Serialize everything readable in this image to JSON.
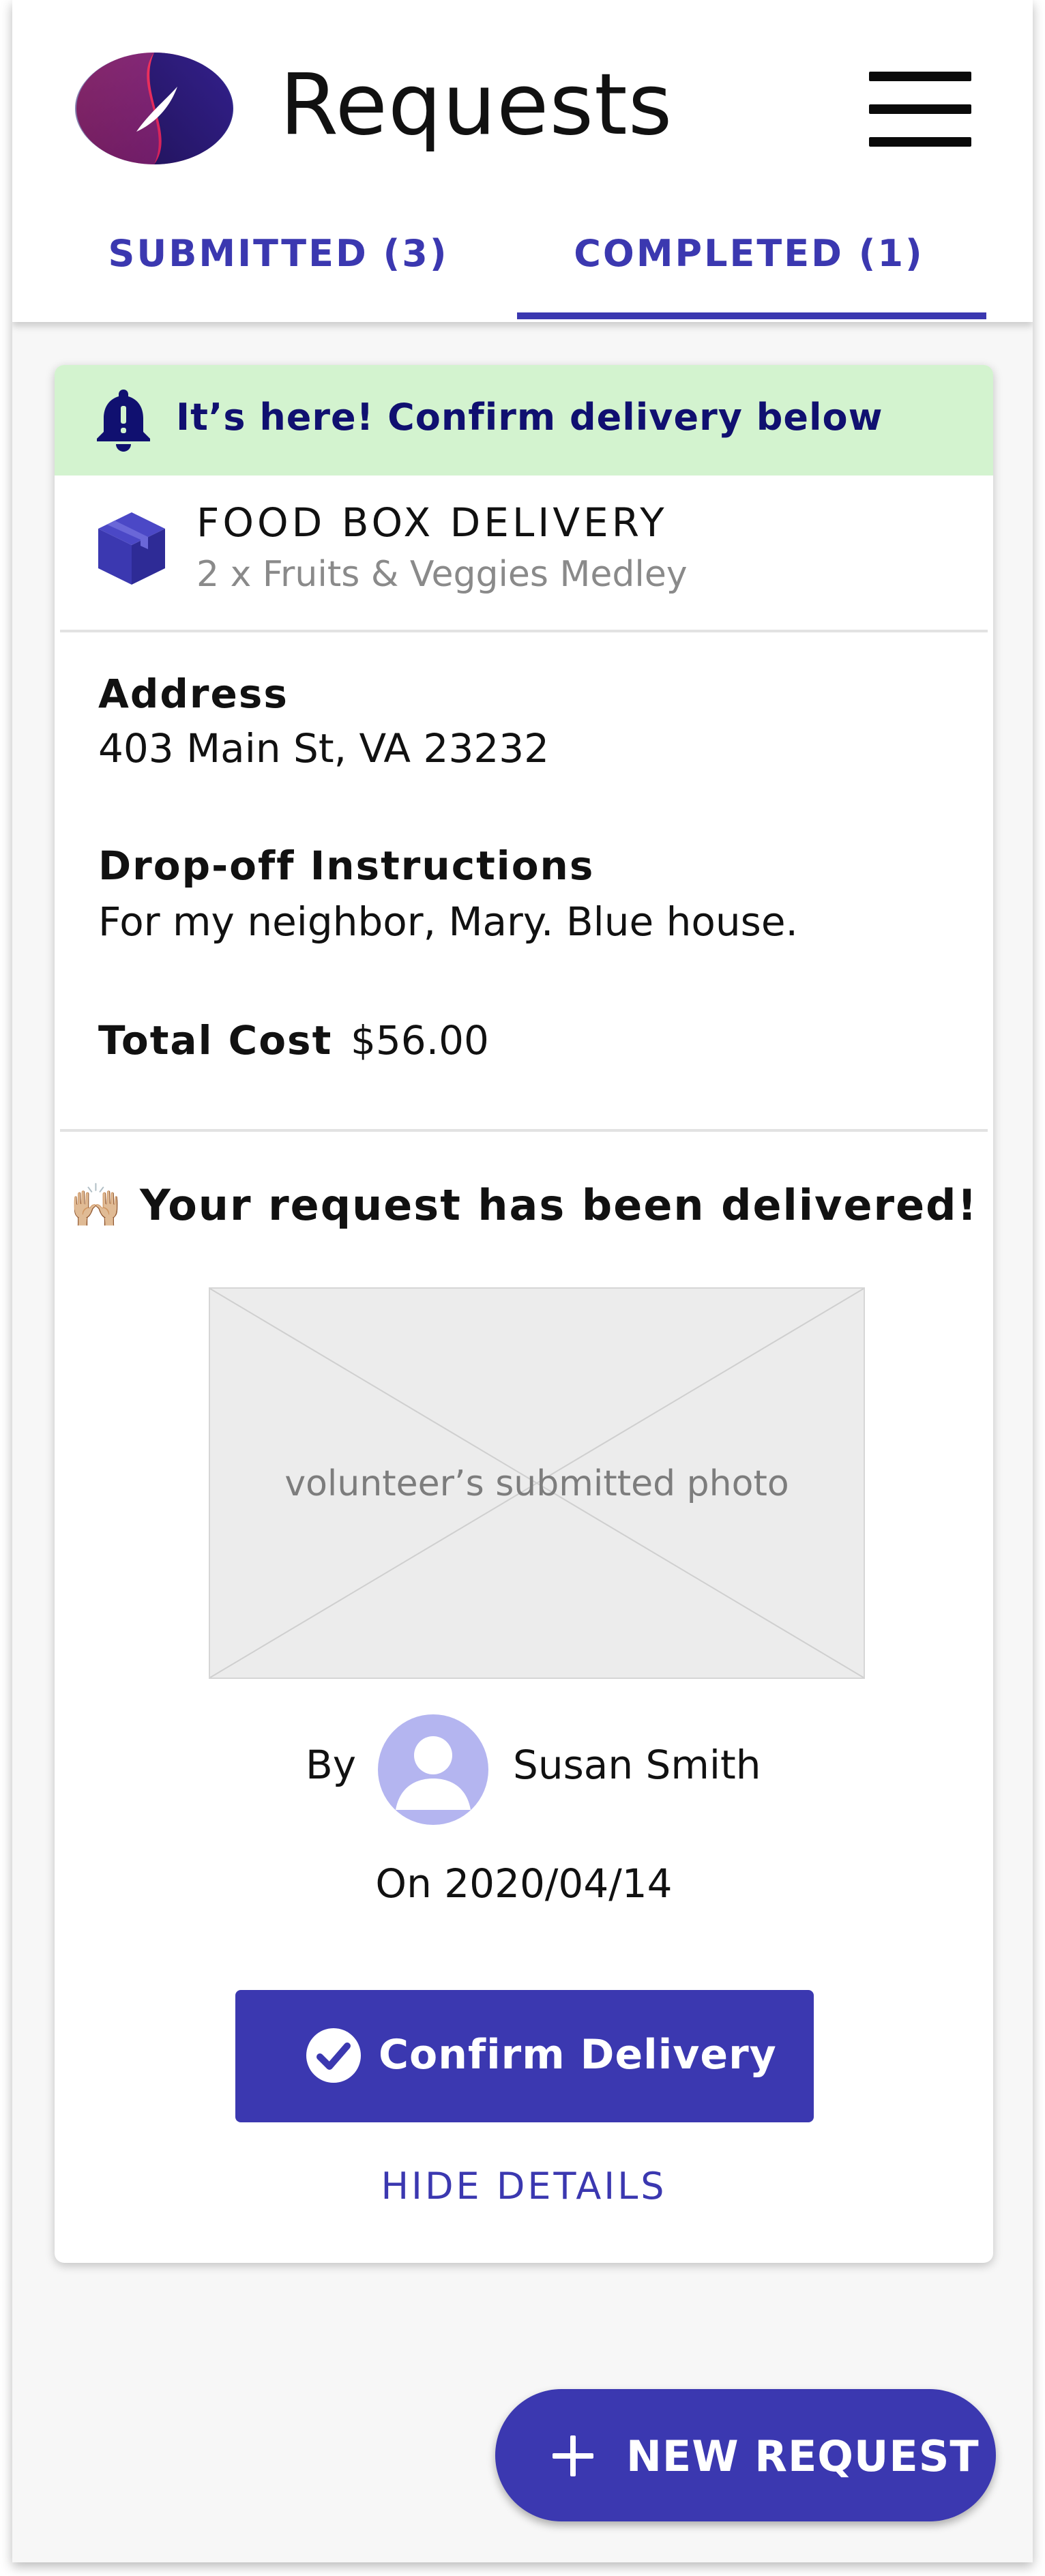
{
  "header": {
    "title": "Requests",
    "logo_icon": "app-logo",
    "menu_icon": "hamburger-menu-icon"
  },
  "tabs": [
    {
      "label": "SUBMITTED (3)",
      "active": false
    },
    {
      "label": "COMPLETED (1)",
      "active": true
    }
  ],
  "card": {
    "banner": {
      "icon": "bell-alert-icon",
      "text": "It’s here! Confirm delivery below"
    },
    "item": {
      "icon": "box-icon",
      "title": "FOOD BOX DELIVERY",
      "subtitle": "2 x Fruits & Veggies Medley"
    },
    "address": {
      "label": "Address",
      "value": "403 Main St, VA 23232"
    },
    "instructions": {
      "label": "Drop-off Instructions",
      "value": "For my neighbor, Mary. Blue house."
    },
    "cost": {
      "label": "Total Cost",
      "value": "$56.00"
    },
    "delivery": {
      "message": "🙌🏼 Your request has been delivered!",
      "photo_placeholder": "volunteer’s submitted photo",
      "by_label": "By",
      "volunteer_name": "Susan Smith",
      "date": "On 2020/04/14"
    },
    "confirm_button": {
      "icon": "check-circle-icon",
      "label": "Confirm Delivery"
    },
    "hide_details": "HIDE DETAILS"
  },
  "fab": {
    "icon": "plus-icon",
    "label": "NEW REQUEST"
  },
  "colors": {
    "accent": "#3b38b0",
    "banner_bg": "#d3f3cf",
    "banner_text": "#101070",
    "avatar_bg": "#b4b5f0"
  }
}
